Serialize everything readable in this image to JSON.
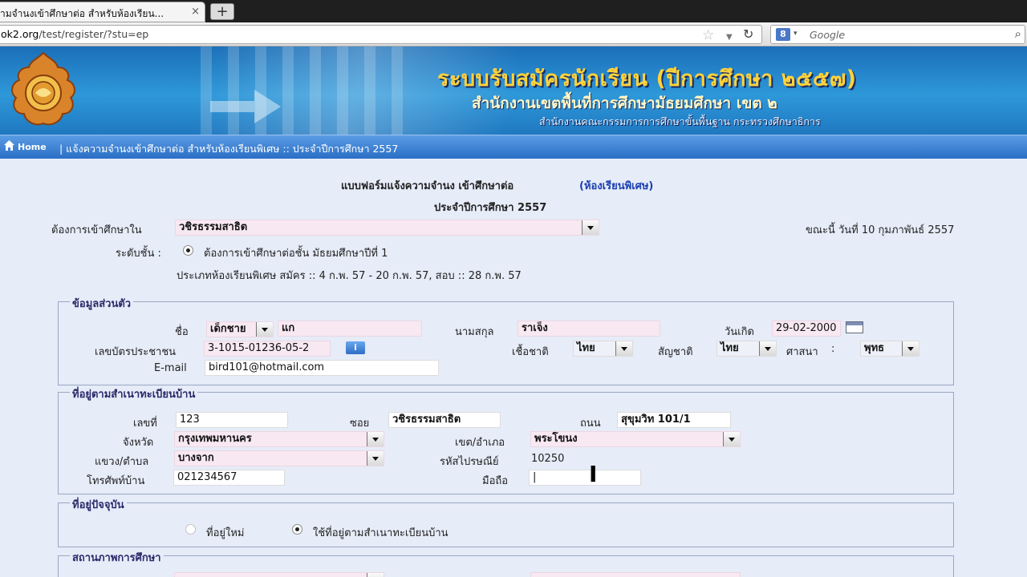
{
  "browser": {
    "tab_title": "ามจำนงเข้าศึกษาต่อ สำหรับห้องเรียน...",
    "tab_close": "×",
    "new_tab": "+",
    "url_host": "ok2.org",
    "url_path": "/test/register/?stu=ep",
    "search_engine_badge": "8",
    "search_placeholder": "Google"
  },
  "banner": {
    "title": "ระบบรับสมัครนักเรียน (ปีการศึกษา ๒๕๕๗)",
    "subtitle": "สำนักงานเขตพื้นที่การศึกษามัธยมศึกษา  เขต ๒",
    "subtitle2": "สำนักงานคณะกรรมการการศึกษาขั้นพื้นฐาน กระทรวงศึกษาธิการ"
  },
  "breadcrumb": {
    "home": "Home",
    "path": "|  แจ้งความจำนงเข้าศึกษาต่อ สำหรับห้องเรียนพิเศษ  ::  ประจำปีการศึกษา 2557"
  },
  "form": {
    "heading": "แบบฟอร์มแจ้งความจำนง เข้าศึกษาต่อ",
    "heading_link": "(ห้องเรียนพิเศษ)",
    "year_line": "ประจำปีการศึกษา 2557",
    "school_label": "ต้องการเข้าศึกษาใน",
    "school_value": "วชิรธรรมสาธิต",
    "date_now": "ขณะนี้ วันที่ 10 กุมภาพันธ์ 2557",
    "level_label": "ระดับชั้น :",
    "level_value": "ต้องการเข้าศึกษาต่อชั้น มัธยมศึกษาปีที่ 1",
    "type_line": "ประเภทห้องเรียนพิเศษ  สมัคร :: 4 ก.พ. 57 - 20 ก.พ. 57,    สอบ :: 28 ก.พ. 57"
  },
  "personal": {
    "legend": "ข้อมูลส่วนตัว",
    "name_label": "ชื่อ",
    "prefix_value": "เด็กชาย",
    "first_name": "แก",
    "surname_label": "นามสกุล",
    "surname": "ราเจ็ง",
    "birth_label": "วันเกิด",
    "birth_value": "29-02-2000",
    "id_label": "เลขบัตรประชาชน",
    "id_value": "3-1015-01236-05-2",
    "info_badge": "i",
    "race_label": "เชื้อชาติ",
    "race_value": "ไทย",
    "nationality_label": "สัญชาติ",
    "nationality_value": "ไทย",
    "religion_label": "ศาสนา",
    "religion_value": "พุทธ",
    "email_label": "E-mail",
    "email_value": "bird101@hotmail.com"
  },
  "address": {
    "legend": "ที่อยู่ตามสำเนาทะเบียนบ้าน",
    "house_no_label": "เลขที่",
    "house_no": "123",
    "soi_label": "ซอย",
    "soi": "วชิรธรรมสาธิต",
    "road_label": "ถนน",
    "road": "สุขุมวิท 101/1",
    "province_label": "จังหวัด",
    "province": "กรุงเทพมหานคร",
    "district_label": "เขต/อำเภอ",
    "district": "พระโขนง",
    "subdistrict_label": "แขวง/ตำบล",
    "subdistrict": "บางจาก",
    "postcode_label": "รหัสไปรษณีย์",
    "postcode": "10250",
    "phone_label": "โทรศัพท์บ้าน",
    "phone": "021234567",
    "mobile_label": "มือถือ",
    "mobile": "|"
  },
  "current_address": {
    "legend": "ที่อยู่ปัจจุบัน",
    "option_new": "ที่อยู่ใหม่",
    "option_same": "ใช้ที่อยู่ตามสำเนาทะเบียนบ้าน"
  },
  "education": {
    "legend": "สถานภาพการศึกษา"
  }
}
